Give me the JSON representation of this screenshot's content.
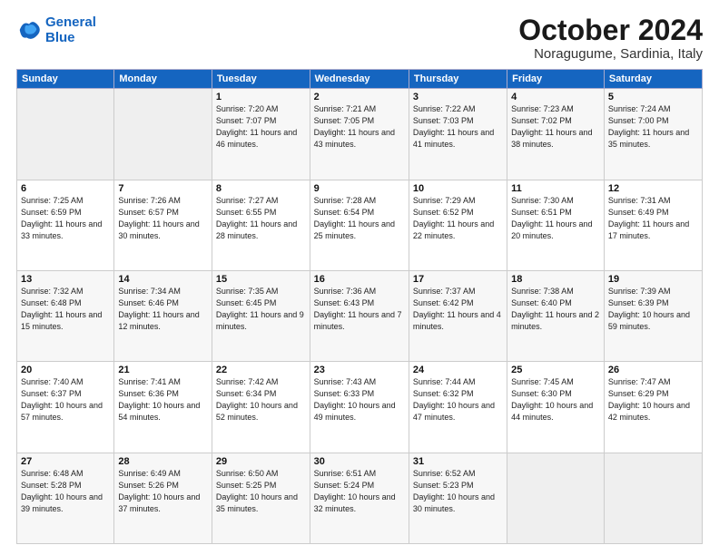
{
  "logo": {
    "line1": "General",
    "line2": "Blue"
  },
  "title": "October 2024",
  "location": "Noragugume, Sardinia, Italy",
  "weekdays": [
    "Sunday",
    "Monday",
    "Tuesday",
    "Wednesday",
    "Thursday",
    "Friday",
    "Saturday"
  ],
  "weeks": [
    [
      {
        "day": "",
        "info": ""
      },
      {
        "day": "",
        "info": ""
      },
      {
        "day": "1",
        "info": "Sunrise: 7:20 AM\nSunset: 7:07 PM\nDaylight: 11 hours and 46 minutes."
      },
      {
        "day": "2",
        "info": "Sunrise: 7:21 AM\nSunset: 7:05 PM\nDaylight: 11 hours and 43 minutes."
      },
      {
        "day": "3",
        "info": "Sunrise: 7:22 AM\nSunset: 7:03 PM\nDaylight: 11 hours and 41 minutes."
      },
      {
        "day": "4",
        "info": "Sunrise: 7:23 AM\nSunset: 7:02 PM\nDaylight: 11 hours and 38 minutes."
      },
      {
        "day": "5",
        "info": "Sunrise: 7:24 AM\nSunset: 7:00 PM\nDaylight: 11 hours and 35 minutes."
      }
    ],
    [
      {
        "day": "6",
        "info": "Sunrise: 7:25 AM\nSunset: 6:59 PM\nDaylight: 11 hours and 33 minutes."
      },
      {
        "day": "7",
        "info": "Sunrise: 7:26 AM\nSunset: 6:57 PM\nDaylight: 11 hours and 30 minutes."
      },
      {
        "day": "8",
        "info": "Sunrise: 7:27 AM\nSunset: 6:55 PM\nDaylight: 11 hours and 28 minutes."
      },
      {
        "day": "9",
        "info": "Sunrise: 7:28 AM\nSunset: 6:54 PM\nDaylight: 11 hours and 25 minutes."
      },
      {
        "day": "10",
        "info": "Sunrise: 7:29 AM\nSunset: 6:52 PM\nDaylight: 11 hours and 22 minutes."
      },
      {
        "day": "11",
        "info": "Sunrise: 7:30 AM\nSunset: 6:51 PM\nDaylight: 11 hours and 20 minutes."
      },
      {
        "day": "12",
        "info": "Sunrise: 7:31 AM\nSunset: 6:49 PM\nDaylight: 11 hours and 17 minutes."
      }
    ],
    [
      {
        "day": "13",
        "info": "Sunrise: 7:32 AM\nSunset: 6:48 PM\nDaylight: 11 hours and 15 minutes."
      },
      {
        "day": "14",
        "info": "Sunrise: 7:34 AM\nSunset: 6:46 PM\nDaylight: 11 hours and 12 minutes."
      },
      {
        "day": "15",
        "info": "Sunrise: 7:35 AM\nSunset: 6:45 PM\nDaylight: 11 hours and 9 minutes."
      },
      {
        "day": "16",
        "info": "Sunrise: 7:36 AM\nSunset: 6:43 PM\nDaylight: 11 hours and 7 minutes."
      },
      {
        "day": "17",
        "info": "Sunrise: 7:37 AM\nSunset: 6:42 PM\nDaylight: 11 hours and 4 minutes."
      },
      {
        "day": "18",
        "info": "Sunrise: 7:38 AM\nSunset: 6:40 PM\nDaylight: 11 hours and 2 minutes."
      },
      {
        "day": "19",
        "info": "Sunrise: 7:39 AM\nSunset: 6:39 PM\nDaylight: 10 hours and 59 minutes."
      }
    ],
    [
      {
        "day": "20",
        "info": "Sunrise: 7:40 AM\nSunset: 6:37 PM\nDaylight: 10 hours and 57 minutes."
      },
      {
        "day": "21",
        "info": "Sunrise: 7:41 AM\nSunset: 6:36 PM\nDaylight: 10 hours and 54 minutes."
      },
      {
        "day": "22",
        "info": "Sunrise: 7:42 AM\nSunset: 6:34 PM\nDaylight: 10 hours and 52 minutes."
      },
      {
        "day": "23",
        "info": "Sunrise: 7:43 AM\nSunset: 6:33 PM\nDaylight: 10 hours and 49 minutes."
      },
      {
        "day": "24",
        "info": "Sunrise: 7:44 AM\nSunset: 6:32 PM\nDaylight: 10 hours and 47 minutes."
      },
      {
        "day": "25",
        "info": "Sunrise: 7:45 AM\nSunset: 6:30 PM\nDaylight: 10 hours and 44 minutes."
      },
      {
        "day": "26",
        "info": "Sunrise: 7:47 AM\nSunset: 6:29 PM\nDaylight: 10 hours and 42 minutes."
      }
    ],
    [
      {
        "day": "27",
        "info": "Sunrise: 6:48 AM\nSunset: 5:28 PM\nDaylight: 10 hours and 39 minutes."
      },
      {
        "day": "28",
        "info": "Sunrise: 6:49 AM\nSunset: 5:26 PM\nDaylight: 10 hours and 37 minutes."
      },
      {
        "day": "29",
        "info": "Sunrise: 6:50 AM\nSunset: 5:25 PM\nDaylight: 10 hours and 35 minutes."
      },
      {
        "day": "30",
        "info": "Sunrise: 6:51 AM\nSunset: 5:24 PM\nDaylight: 10 hours and 32 minutes."
      },
      {
        "day": "31",
        "info": "Sunrise: 6:52 AM\nSunset: 5:23 PM\nDaylight: 10 hours and 30 minutes."
      },
      {
        "day": "",
        "info": ""
      },
      {
        "day": "",
        "info": ""
      }
    ]
  ]
}
